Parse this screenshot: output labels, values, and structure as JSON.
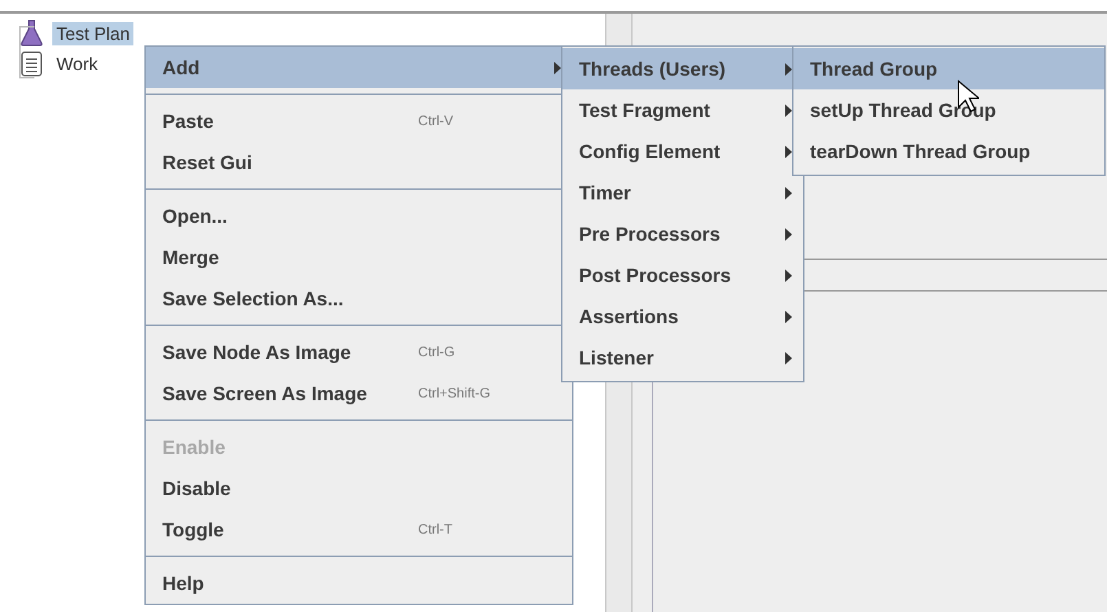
{
  "tree": {
    "items": [
      {
        "label": "Test Plan",
        "kind": "plan",
        "selected": true
      },
      {
        "label": "Work",
        "kind": "workbench",
        "selected": false
      }
    ]
  },
  "context_menu": {
    "groups": [
      [
        {
          "label": "Add",
          "has_submenu": true,
          "disabled": false,
          "selected": true
        }
      ],
      [
        {
          "label": "Paste",
          "shortcut": "Ctrl-V",
          "disabled": false,
          "selected": false
        },
        {
          "label": "Reset Gui",
          "disabled": false,
          "selected": false
        }
      ],
      [
        {
          "label": "Open...",
          "disabled": false,
          "selected": false
        },
        {
          "label": "Merge",
          "disabled": false,
          "selected": false
        },
        {
          "label": "Save Selection As...",
          "disabled": false,
          "selected": false
        }
      ],
      [
        {
          "label": "Save Node As Image",
          "shortcut": "Ctrl-G",
          "disabled": false,
          "selected": false
        },
        {
          "label": "Save Screen As Image",
          "shortcut": "Ctrl+Shift-G",
          "disabled": false,
          "selected": false
        }
      ],
      [
        {
          "label": "Enable",
          "disabled": true,
          "selected": false
        },
        {
          "label": "Disable",
          "disabled": false,
          "selected": false
        },
        {
          "label": "Toggle",
          "shortcut": "Ctrl-T",
          "disabled": false,
          "selected": false
        }
      ],
      [
        {
          "label": "Help",
          "disabled": false,
          "selected": false
        }
      ]
    ]
  },
  "add_submenu": {
    "items": [
      {
        "label": "Threads (Users)",
        "has_submenu": true,
        "selected": true
      },
      {
        "label": "Test Fragment",
        "has_submenu": true,
        "selected": false
      },
      {
        "label": "Config Element",
        "has_submenu": true,
        "selected": false
      },
      {
        "label": "Timer",
        "has_submenu": true,
        "selected": false
      },
      {
        "label": "Pre Processors",
        "has_submenu": true,
        "selected": false
      },
      {
        "label": "Post Processors",
        "has_submenu": true,
        "selected": false
      },
      {
        "label": "Assertions",
        "has_submenu": true,
        "selected": false
      },
      {
        "label": "Listener",
        "has_submenu": true,
        "selected": false
      }
    ]
  },
  "threads_submenu": {
    "items": [
      {
        "label": "Thread Group",
        "selected": true
      },
      {
        "label": "setUp Thread Group",
        "selected": false
      },
      {
        "label": "tearDown Thread Group",
        "selected": false
      }
    ]
  }
}
